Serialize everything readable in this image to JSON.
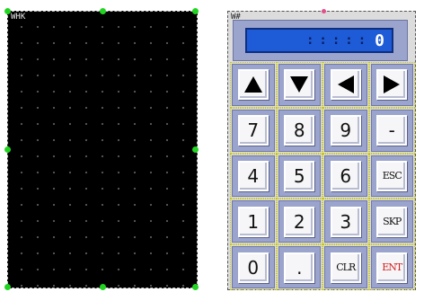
{
  "left_frame": {
    "label": "WHK"
  },
  "keypad": {
    "label": "W#",
    "display": {
      "placeholder": ":::::",
      "value": "0"
    },
    "arrows": {
      "up_icon": "arrow-up-icon",
      "down_icon": "arrow-down-icon",
      "left_icon": "arrow-left-icon",
      "right_icon": "arrow-right-icon"
    },
    "keys": {
      "k7": "7",
      "k8": "8",
      "k9": "9",
      "minus": "-",
      "k4": "4",
      "k5": "5",
      "k6": "6",
      "esc": "ESC",
      "k1": "1",
      "k2": "2",
      "k3": "3",
      "skip": "SKP",
      "k0": "0",
      "dot": ".",
      "clr": "CLR",
      "ent": "ENT"
    },
    "colors": {
      "display_bg": "#1e5bd6",
      "key_frame": "#9aa4cc",
      "ent_text": "#d21e1e",
      "handle": "#22d422"
    }
  }
}
